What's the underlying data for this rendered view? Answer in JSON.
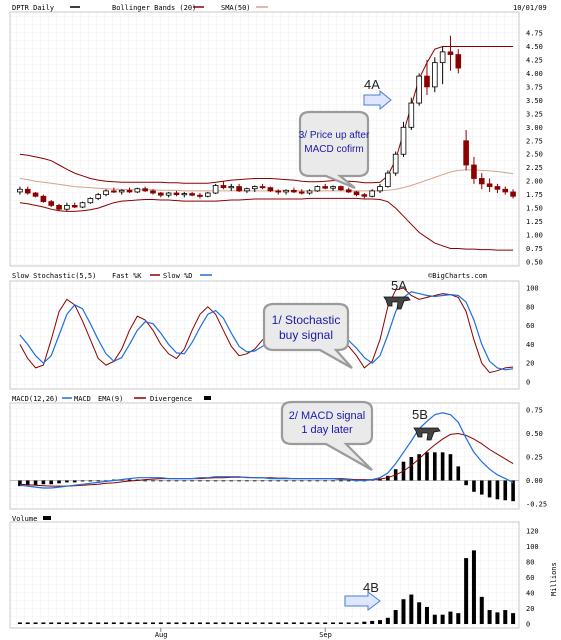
{
  "chart_data": [
    {
      "type": "candlestick",
      "panel": "price",
      "title": "DPTR Daily",
      "date": "10/01/09",
      "legend": [
        {
          "name": "DPTR Daily",
          "color": "#000000"
        },
        {
          "name": "Bollinger Bands (20)",
          "color": "#8b0000"
        },
        {
          "name": "SMA(50)",
          "color": "#d2a38a"
        }
      ],
      "y_ticks": [
        "4.75",
        "4.50",
        "4.25",
        "4.00",
        "3.75",
        "3.50",
        "3.25",
        "3.00",
        "2.75",
        "2.50",
        "2.25",
        "2.00",
        "1.75",
        "1.50",
        "1.25",
        "1.00",
        "0.75",
        "0.50"
      ],
      "ylim": [
        0.5,
        4.75
      ],
      "x_ticks": [
        "Aug",
        "Sep"
      ],
      "candles": [
        [
          1.8,
          1.9,
          1.75,
          1.85
        ],
        [
          1.85,
          1.9,
          1.75,
          1.78
        ],
        [
          1.78,
          1.8,
          1.7,
          1.72
        ],
        [
          1.72,
          1.75,
          1.6,
          1.62
        ],
        [
          1.62,
          1.65,
          1.52,
          1.55
        ],
        [
          1.55,
          1.58,
          1.45,
          1.48
        ],
        [
          1.48,
          1.6,
          1.45,
          1.55
        ],
        [
          1.55,
          1.6,
          1.5,
          1.52
        ],
        [
          1.52,
          1.62,
          1.5,
          1.6
        ],
        [
          1.6,
          1.7,
          1.58,
          1.68
        ],
        [
          1.68,
          1.78,
          1.65,
          1.75
        ],
        [
          1.75,
          1.85,
          1.72,
          1.82
        ],
        [
          1.82,
          1.88,
          1.78,
          1.8
        ],
        [
          1.8,
          1.85,
          1.75,
          1.83
        ],
        [
          1.83,
          1.88,
          1.78,
          1.8
        ],
        [
          1.8,
          1.88,
          1.78,
          1.86
        ],
        [
          1.86,
          1.9,
          1.8,
          1.82
        ],
        [
          1.82,
          1.85,
          1.75,
          1.78
        ],
        [
          1.78,
          1.8,
          1.7,
          1.74
        ],
        [
          1.74,
          1.8,
          1.7,
          1.78
        ],
        [
          1.78,
          1.82,
          1.72,
          1.75
        ],
        [
          1.75,
          1.8,
          1.7,
          1.77
        ],
        [
          1.77,
          1.8,
          1.72,
          1.74
        ],
        [
          1.74,
          1.78,
          1.68,
          1.72
        ],
        [
          1.72,
          1.8,
          1.7,
          1.78
        ],
        [
          1.78,
          1.95,
          1.76,
          1.92
        ],
        [
          1.92,
          2.0,
          1.85,
          1.88
        ],
        [
          1.88,
          1.95,
          1.82,
          1.9
        ],
        [
          1.9,
          1.95,
          1.8,
          1.82
        ],
        [
          1.82,
          1.88,
          1.78,
          1.86
        ],
        [
          1.86,
          1.92,
          1.8,
          1.9
        ],
        [
          1.9,
          1.95,
          1.85,
          1.88
        ],
        [
          1.88,
          1.9,
          1.8,
          1.82
        ],
        [
          1.82,
          1.85,
          1.75,
          1.8
        ],
        [
          1.8,
          1.85,
          1.75,
          1.83
        ],
        [
          1.83,
          1.88,
          1.78,
          1.8
        ],
        [
          1.8,
          1.85,
          1.75,
          1.78
        ],
        [
          1.78,
          1.85,
          1.75,
          1.82
        ],
        [
          1.82,
          1.92,
          1.8,
          1.9
        ],
        [
          1.9,
          1.95,
          1.85,
          1.87
        ],
        [
          1.87,
          1.92,
          1.82,
          1.9
        ],
        [
          1.9,
          1.92,
          1.82,
          1.84
        ],
        [
          1.84,
          1.88,
          1.78,
          1.8
        ],
        [
          1.8,
          1.82,
          1.72,
          1.75
        ],
        [
          1.75,
          1.78,
          1.68,
          1.72
        ],
        [
          1.72,
          1.85,
          1.7,
          1.82
        ],
        [
          1.82,
          1.95,
          1.78,
          1.9
        ],
        [
          1.9,
          2.2,
          1.88,
          2.15
        ],
        [
          2.15,
          2.55,
          2.1,
          2.5
        ],
        [
          2.5,
          3.1,
          2.45,
          3.0
        ],
        [
          3.0,
          3.55,
          2.95,
          3.45
        ],
        [
          3.45,
          4.0,
          3.4,
          3.95
        ],
        [
          3.95,
          4.25,
          3.6,
          3.75
        ],
        [
          3.75,
          4.3,
          3.65,
          4.2
        ],
        [
          4.2,
          4.5,
          3.8,
          4.4
        ],
        [
          4.4,
          4.7,
          4.05,
          4.35
        ],
        [
          4.35,
          4.45,
          4.0,
          4.1
        ],
        [
          2.75,
          2.95,
          2.2,
          2.3
        ],
        [
          2.3,
          2.45,
          1.95,
          2.05
        ],
        [
          2.05,
          2.15,
          1.85,
          1.95
        ],
        [
          1.95,
          2.05,
          1.8,
          1.9
        ],
        [
          1.9,
          1.95,
          1.78,
          1.85
        ],
        [
          1.85,
          1.9,
          1.75,
          1.8
        ],
        [
          1.8,
          1.85,
          1.68,
          1.72
        ]
      ],
      "bollinger_upper": [
        2.5,
        2.48,
        2.45,
        2.42,
        2.38,
        2.3,
        2.22,
        2.15,
        2.1,
        2.05,
        2.02,
        2.0,
        1.99,
        1.98,
        1.98,
        1.98,
        1.98,
        1.98,
        1.98,
        1.97,
        1.97,
        1.96,
        1.96,
        1.96,
        1.96,
        1.98,
        2.0,
        2.02,
        2.03,
        2.04,
        2.05,
        2.05,
        2.05,
        2.04,
        2.03,
        2.02,
        2.0,
        1.99,
        1.99,
        2.0,
        2.01,
        2.01,
        2.0,
        1.99,
        1.97,
        1.97,
        1.98,
        2.1,
        2.4,
        2.9,
        3.4,
        3.9,
        4.2,
        4.45,
        4.5,
        4.5,
        4.5,
        4.5,
        4.5,
        4.5,
        4.5,
        4.5,
        4.5,
        4.5
      ],
      "bollinger_lower": [
        1.6,
        1.58,
        1.55,
        1.52,
        1.48,
        1.45,
        1.44,
        1.44,
        1.45,
        1.47,
        1.5,
        1.55,
        1.6,
        1.63,
        1.64,
        1.65,
        1.66,
        1.66,
        1.65,
        1.65,
        1.64,
        1.63,
        1.63,
        1.63,
        1.63,
        1.63,
        1.64,
        1.65,
        1.65,
        1.66,
        1.67,
        1.67,
        1.67,
        1.67,
        1.67,
        1.67,
        1.67,
        1.68,
        1.68,
        1.68,
        1.68,
        1.68,
        1.68,
        1.68,
        1.67,
        1.67,
        1.66,
        1.62,
        1.5,
        1.35,
        1.2,
        1.05,
        0.95,
        0.85,
        0.8,
        0.75,
        0.75,
        0.74,
        0.74,
        0.73,
        0.73,
        0.72,
        0.72,
        0.72
      ],
      "sma50": [
        2.05,
        2.03,
        2.0,
        1.98,
        1.96,
        1.94,
        1.92,
        1.9,
        1.89,
        1.88,
        1.87,
        1.86,
        1.85,
        1.85,
        1.84,
        1.84,
        1.84,
        1.84,
        1.83,
        1.83,
        1.83,
        1.82,
        1.82,
        1.82,
        1.82,
        1.82,
        1.82,
        1.82,
        1.82,
        1.82,
        1.82,
        1.82,
        1.82,
        1.82,
        1.82,
        1.82,
        1.82,
        1.82,
        1.82,
        1.82,
        1.82,
        1.82,
        1.82,
        1.82,
        1.82,
        1.82,
        1.82,
        1.83,
        1.85,
        1.88,
        1.92,
        1.97,
        2.02,
        2.07,
        2.12,
        2.17,
        2.2,
        2.21,
        2.21,
        2.2,
        2.19,
        2.18,
        2.16,
        2.14
      ]
    },
    {
      "type": "line",
      "panel": "stochastic",
      "title": "Slow Stochastic(5,5)",
      "legend": [
        {
          "name": "Fast %K",
          "color": "#8b0000"
        },
        {
          "name": "Slow %D",
          "color": "#1e6ee0"
        }
      ],
      "watermark": "©BigCharts.com",
      "y_ticks": [
        "100",
        "80",
        "60",
        "40",
        "20",
        "0"
      ],
      "ylim": [
        0,
        100
      ],
      "series": [
        {
          "name": "Fast %K",
          "values": [
            40,
            25,
            15,
            18,
            45,
            75,
            88,
            82,
            65,
            45,
            25,
            18,
            22,
            35,
            55,
            70,
            66,
            55,
            40,
            30,
            25,
            35,
            55,
            72,
            80,
            72,
            55,
            38,
            28,
            30,
            35,
            45,
            50,
            55,
            48,
            42,
            45,
            50,
            55,
            58,
            52,
            45,
            38,
            28,
            15,
            22,
            45,
            80,
            98,
            100,
            92,
            88,
            90,
            92,
            94,
            93,
            90,
            75,
            45,
            20,
            10,
            12,
            15,
            16
          ]
        },
        {
          "name": "Slow %D",
          "values": [
            50,
            40,
            28,
            20,
            28,
            50,
            72,
            82,
            78,
            62,
            45,
            30,
            22,
            26,
            40,
            55,
            64,
            62,
            52,
            40,
            31,
            30,
            42,
            58,
            72,
            76,
            68,
            52,
            38,
            32,
            33,
            38,
            44,
            50,
            50,
            46,
            45,
            47,
            50,
            54,
            54,
            50,
            44,
            36,
            26,
            20,
            28,
            50,
            75,
            90,
            96,
            94,
            92,
            91,
            92,
            93,
            92,
            85,
            66,
            40,
            22,
            15,
            13,
            14
          ]
        }
      ]
    },
    {
      "type": "bar-line",
      "panel": "macd",
      "title": "MACD(12,26)",
      "legend": [
        {
          "name": "MACD",
          "color": "#1e6ee0"
        },
        {
          "name": "EMA(9)",
          "color": "#8b0000"
        },
        {
          "name": "Divergence",
          "color": "#000000"
        }
      ],
      "y_ticks": [
        "0.75",
        "0.50",
        "0.25",
        "0.00",
        "-0.25"
      ],
      "ylim": [
        -0.3,
        0.8
      ],
      "series": [
        {
          "name": "MACD",
          "values": [
            -0.05,
            -0.06,
            -0.07,
            -0.08,
            -0.08,
            -0.07,
            -0.06,
            -0.05,
            -0.04,
            -0.03,
            -0.02,
            -0.01,
            0.0,
            0.01,
            0.02,
            0.03,
            0.03,
            0.03,
            0.03,
            0.02,
            0.02,
            0.02,
            0.02,
            0.03,
            0.03,
            0.04,
            0.04,
            0.04,
            0.04,
            0.03,
            0.03,
            0.03,
            0.02,
            0.02,
            0.02,
            0.02,
            0.02,
            0.02,
            0.02,
            0.02,
            0.02,
            0.01,
            0.01,
            0.0,
            0.0,
            0.01,
            0.03,
            0.08,
            0.18,
            0.3,
            0.42,
            0.55,
            0.63,
            0.7,
            0.72,
            0.7,
            0.62,
            0.45,
            0.3,
            0.2,
            0.12,
            0.06,
            0.02,
            -0.02
          ]
        },
        {
          "name": "EMA(9)",
          "values": [
            -0.04,
            -0.045,
            -0.05,
            -0.055,
            -0.06,
            -0.06,
            -0.06,
            -0.055,
            -0.05,
            -0.045,
            -0.04,
            -0.03,
            -0.025,
            -0.015,
            -0.005,
            0.0,
            0.01,
            0.015,
            0.02,
            0.02,
            0.02,
            0.02,
            0.02,
            0.02,
            0.025,
            0.03,
            0.03,
            0.035,
            0.035,
            0.035,
            0.03,
            0.03,
            0.03,
            0.025,
            0.025,
            0.02,
            0.02,
            0.02,
            0.02,
            0.02,
            0.02,
            0.02,
            0.015,
            0.01,
            0.01,
            0.01,
            0.015,
            0.03,
            0.06,
            0.1,
            0.16,
            0.23,
            0.31,
            0.38,
            0.44,
            0.49,
            0.5,
            0.48,
            0.44,
            0.39,
            0.33,
            0.28,
            0.23,
            0.18
          ]
        },
        {
          "name": "Divergence",
          "values": [
            -0.06,
            -0.05,
            -0.05,
            -0.04,
            -0.04,
            -0.03,
            -0.02,
            -0.02,
            -0.01,
            -0.01,
            0.0,
            0.0,
            0.01,
            0.01,
            0.01,
            0.01,
            0.0,
            0.0,
            0.0,
            0.0,
            0.0,
            0.0,
            0.0,
            0.0,
            0.0,
            0.0,
            0.0,
            0.0,
            0.0,
            0.0,
            0.0,
            0.0,
            0.0,
            0.0,
            0.0,
            0.0,
            0.0,
            0.0,
            0.0,
            0.0,
            0.0,
            0.0,
            0.0,
            0.0,
            0.0,
            0.01,
            0.02,
            0.05,
            0.12,
            0.2,
            0.25,
            0.28,
            0.3,
            0.3,
            0.3,
            0.28,
            0.15,
            -0.05,
            -0.12,
            -0.15,
            -0.18,
            -0.2,
            -0.21,
            -0.22
          ]
        }
      ]
    },
    {
      "type": "bar",
      "panel": "volume",
      "title": "Volume",
      "ylabel": "Millions",
      "y_ticks": [
        "120",
        "100",
        "80",
        "60",
        "40",
        "20",
        "0"
      ],
      "ylim": [
        0,
        120
      ],
      "values": [
        2,
        2,
        2,
        2,
        2,
        2,
        2,
        2,
        2,
        2,
        2,
        2,
        2,
        2,
        2,
        2,
        2,
        2,
        2,
        2,
        2,
        2,
        2,
        2,
        2,
        2,
        2,
        2,
        2,
        2,
        2,
        2,
        2,
        2,
        2,
        2,
        2,
        2,
        2,
        2,
        2,
        2,
        2,
        2,
        3,
        4,
        5,
        8,
        18,
        32,
        38,
        28,
        22,
        12,
        12,
        16,
        14,
        85,
        95,
        35,
        18,
        15,
        18,
        14
      ]
    }
  ],
  "annotations": {
    "callout_price": [
      "3/ Price up after",
      "MACD cofirm"
    ],
    "callout_stoch": [
      "1/ Stochastic",
      "buy signal"
    ],
    "callout_macd": [
      "2/ MACD signal",
      "1 day later"
    ],
    "tag_4a": "4A",
    "tag_5a": "5A",
    "tag_5b": "5B",
    "tag_4b": "4B"
  }
}
